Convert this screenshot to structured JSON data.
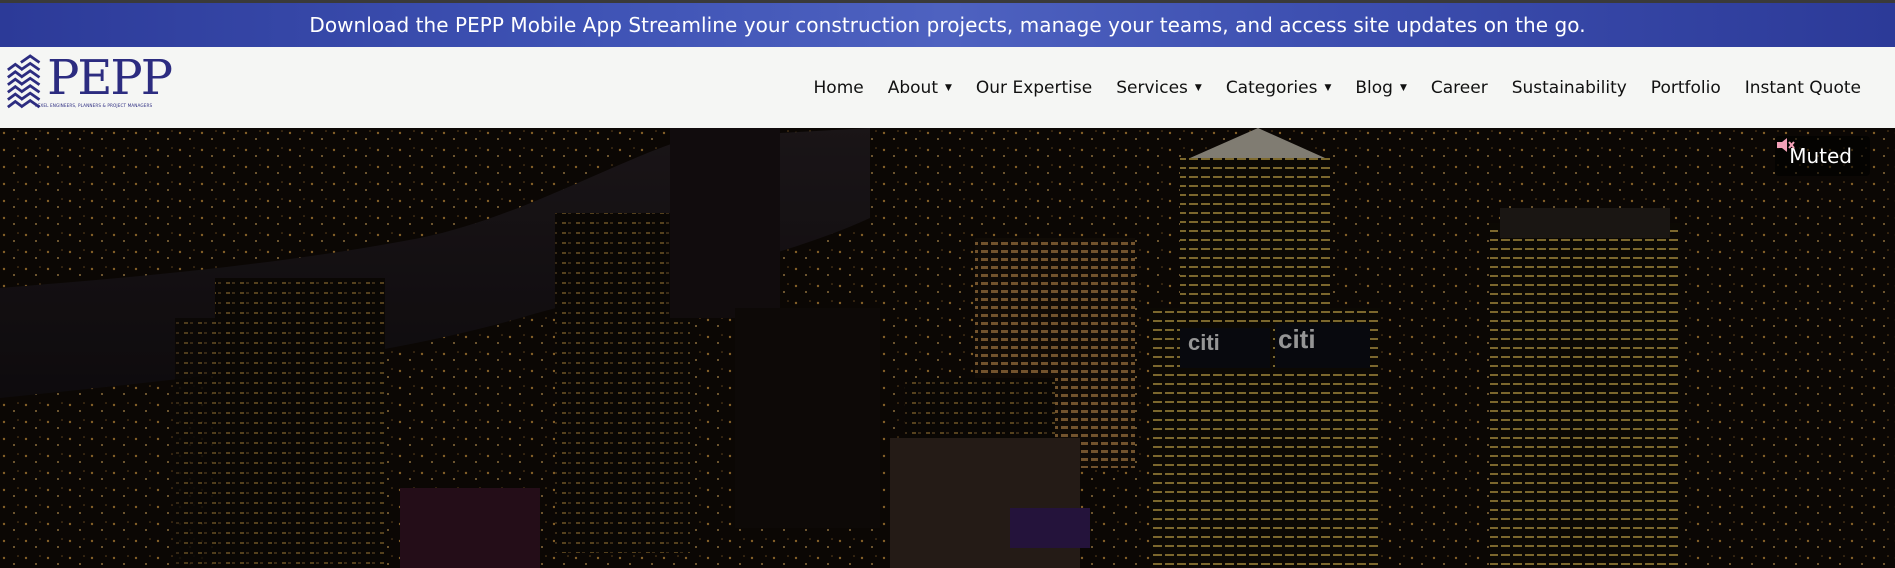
{
  "promo": {
    "text": "Download the PEPP Mobile App Streamline your construction projects, manage your teams, and access site updates on the go."
  },
  "logo": {
    "word": "PEPP",
    "tagline": "PEXEL ENGINEERS, PLANNERS & PROJECT MANAGERS"
  },
  "nav": {
    "items": [
      {
        "label": "Home",
        "dropdown": false
      },
      {
        "label": "About",
        "dropdown": true
      },
      {
        "label": "Our Expertise",
        "dropdown": false
      },
      {
        "label": "Services",
        "dropdown": true
      },
      {
        "label": "Categories",
        "dropdown": true
      },
      {
        "label": "Blog",
        "dropdown": true
      },
      {
        "label": "Career",
        "dropdown": false
      },
      {
        "label": "Sustainability",
        "dropdown": false
      },
      {
        "label": "Portfolio",
        "dropdown": false
      },
      {
        "label": "Instant Quote",
        "dropdown": false
      }
    ],
    "caret": "▼"
  },
  "hero": {
    "mute_label": "Muted",
    "mute_icon": "speaker-muted-icon",
    "sign_labels": [
      "citi",
      "citi"
    ]
  },
  "colors": {
    "promo_bg": "#3e52b4",
    "header_bg": "#f5f6f4",
    "brand": "#2c2c80",
    "hero_bg": "#0a0606"
  }
}
